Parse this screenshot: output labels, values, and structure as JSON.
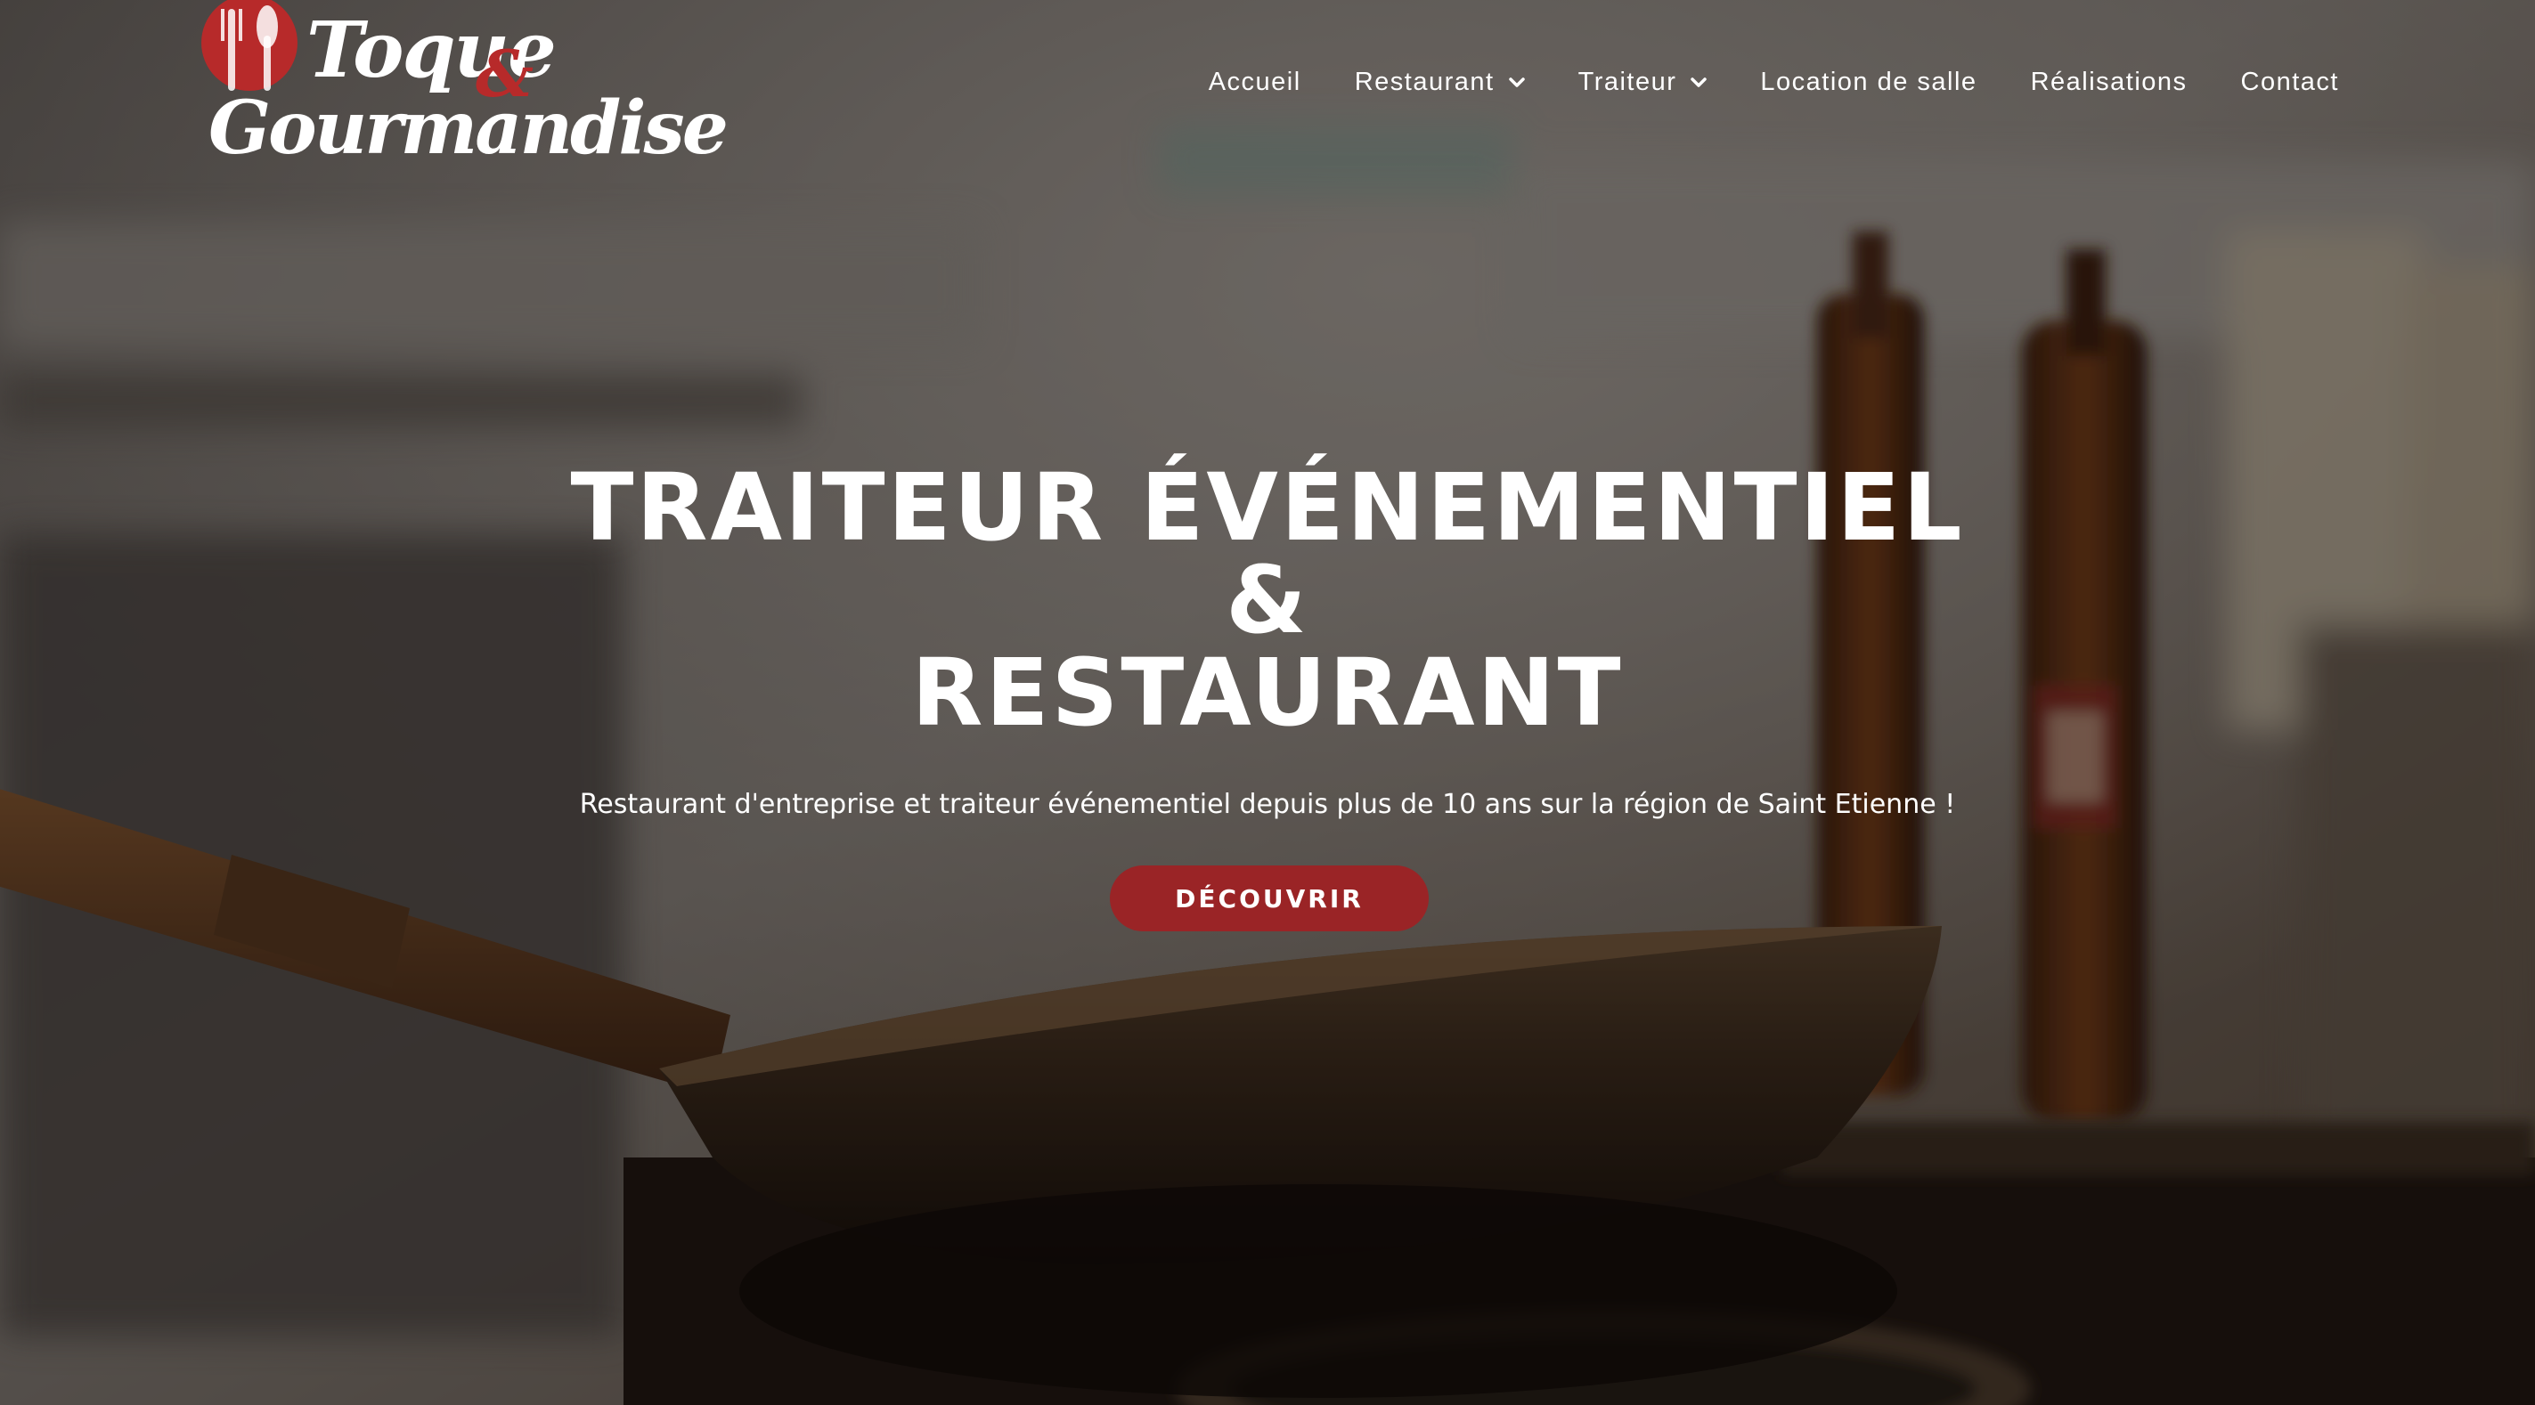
{
  "brand": {
    "name_line1": "Toque",
    "name_amp": "&",
    "name_line2": "Gourmandise",
    "accent_color": "#9a2426"
  },
  "nav": {
    "items": [
      {
        "label": "Accueil",
        "has_dropdown": false
      },
      {
        "label": "Restaurant",
        "has_dropdown": true
      },
      {
        "label": "Traiteur",
        "has_dropdown": true
      },
      {
        "label": "Location de salle",
        "has_dropdown": false
      },
      {
        "label": "Réalisations",
        "has_dropdown": false
      },
      {
        "label": "Contact",
        "has_dropdown": false
      }
    ],
    "dropdown_icon": "chevron-down-icon"
  },
  "hero": {
    "title_line1": "TRAITEUR ÉVÉNEMENTIEL",
    "title_line2": "&",
    "title_line3": "RESTAURANT",
    "subtitle": "Restaurant d'entreprise et traiteur événementiel depuis plus de 10 ans sur la région de Saint Etienne !",
    "cta_label": "DÉCOUVRIR",
    "background": "kitchen-wok-photo"
  }
}
